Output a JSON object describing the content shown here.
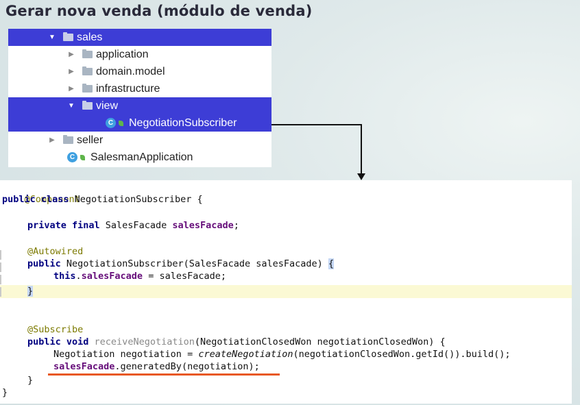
{
  "slide": {
    "title": "Gerar nova venda (módulo de venda)"
  },
  "tree": {
    "items": [
      {
        "label": "sales",
        "arrow": "▼",
        "type": "folder",
        "indent": 0,
        "selected": true
      },
      {
        "label": "application",
        "arrow": "▶",
        "type": "folder",
        "indent": 1,
        "selected": false
      },
      {
        "label": "domain.model",
        "arrow": "▶",
        "type": "folder",
        "indent": 1,
        "selected": false
      },
      {
        "label": "infrastructure",
        "arrow": "▶",
        "type": "folder",
        "indent": 1,
        "selected": false
      },
      {
        "label": "view",
        "arrow": "▼",
        "type": "folder",
        "indent": 1,
        "selected": true
      },
      {
        "label": "NegotiationSubscriber",
        "arrow": "",
        "type": "class",
        "indent": 2,
        "selected": true
      },
      {
        "label": "seller",
        "arrow": "▶",
        "type": "folder",
        "indent": 0,
        "selected": false
      },
      {
        "label": "SalesmanApplication",
        "arrow": "",
        "type": "class",
        "indent": 0,
        "selected": false
      }
    ],
    "class_icon_letter": "C",
    "selection_color": "#3d3dd6"
  },
  "code": {
    "l1": "@Component",
    "l2_kw": "public class ",
    "l2_name": "NegotiationSubscriber {",
    "l4_kw": "private final ",
    "l4_type": "SalesFacade ",
    "l4_field": "salesFacade",
    "l4_end": ";",
    "l6": "@Autowired",
    "l7_kw": "public ",
    "l7_rest": "NegotiationSubscriber(SalesFacade salesFacade) ",
    "l7_brace": "{",
    "l8_kw": "this",
    "l8_dot": ".",
    "l8_field": "salesFacade",
    "l8_rest": " = salesFacade;",
    "l9": "}",
    "l12": "@Subscribe",
    "l13_kw": "public void ",
    "l13_name": "receiveNegotiation",
    "l13_rest": "(NegotiationClosedWon negotiationClosedWon) {",
    "l14_a": "Negotiation negotiation = ",
    "l14_it": "createNegotiation",
    "l14_b": "(negotiationClosedWon.getId()).build();",
    "l15_field": "salesFacade",
    "l15_rest": ".generatedBy(negotiation);",
    "l16": "}",
    "l17": "}"
  },
  "colors": {
    "annotation": "#7c7a00",
    "keyword": "#000080",
    "field": "#660e7a",
    "underline": "#e8571d",
    "current_line": "#fbf9d4"
  }
}
